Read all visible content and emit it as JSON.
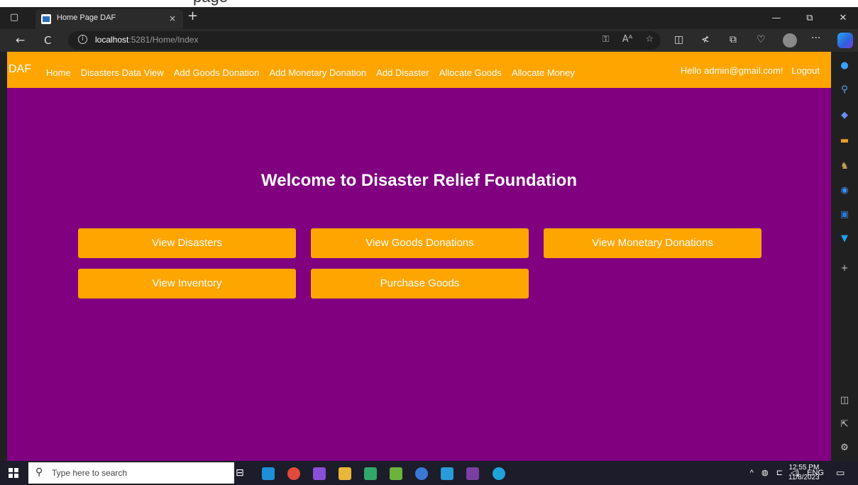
{
  "browser": {
    "tab_title": "Home Page DAF",
    "tab_close": "×",
    "new_tab": "+",
    "url_host": "localhost",
    "url_rest": ":5281/Home/Index",
    "info_glyph": "i",
    "back": "←",
    "refresh": "C",
    "more": "···",
    "win_minimize": "—",
    "win_restore": "⧉",
    "win_close": "✕"
  },
  "page": {
    "brand": "DAF",
    "nav": [
      "Home",
      "Disasters Data View",
      "Add Goods Donation",
      "Add Monetary Donation",
      "Add Disaster",
      "Allocate Goods",
      "Allocate Money"
    ],
    "greeting": "Hello admin@gmail.com!",
    "logout": "Logout",
    "welcome": "Welcome to Disaster Relief Foundation",
    "buttons": [
      "View Disasters",
      "View Goods Donations",
      "View Monetary Donations",
      "View Inventory",
      "Purchase Goods"
    ]
  },
  "colors": {
    "page_background": "#800080",
    "accent": "#ffa500",
    "text": "#ffffff"
  },
  "taskbar": {
    "search_placeholder": "Type here to search",
    "lang": "ENG",
    "time": "12:55 PM",
    "date": "11/8/2023",
    "tray_up": "^"
  }
}
